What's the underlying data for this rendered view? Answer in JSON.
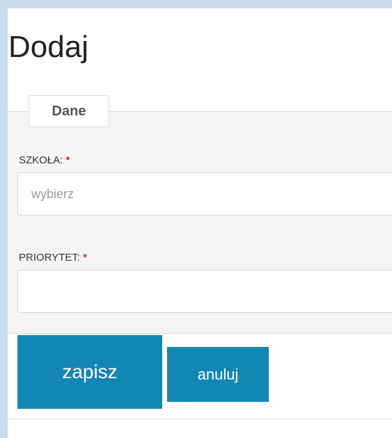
{
  "page": {
    "title": "Dodaj"
  },
  "form": {
    "legend": "Dane",
    "fields": {
      "school": {
        "label": "SZKOŁA:",
        "required_mark": "*",
        "value": "wybierz"
      },
      "priority": {
        "label": "PRIORYTET:",
        "required_mark": "*",
        "value": ""
      }
    },
    "actions": {
      "save_label": "zapisz",
      "cancel_label": "anuluj"
    }
  },
  "colors": {
    "background": "#c9daf1",
    "button": "#1387b4",
    "required": "#cc2a2a"
  }
}
